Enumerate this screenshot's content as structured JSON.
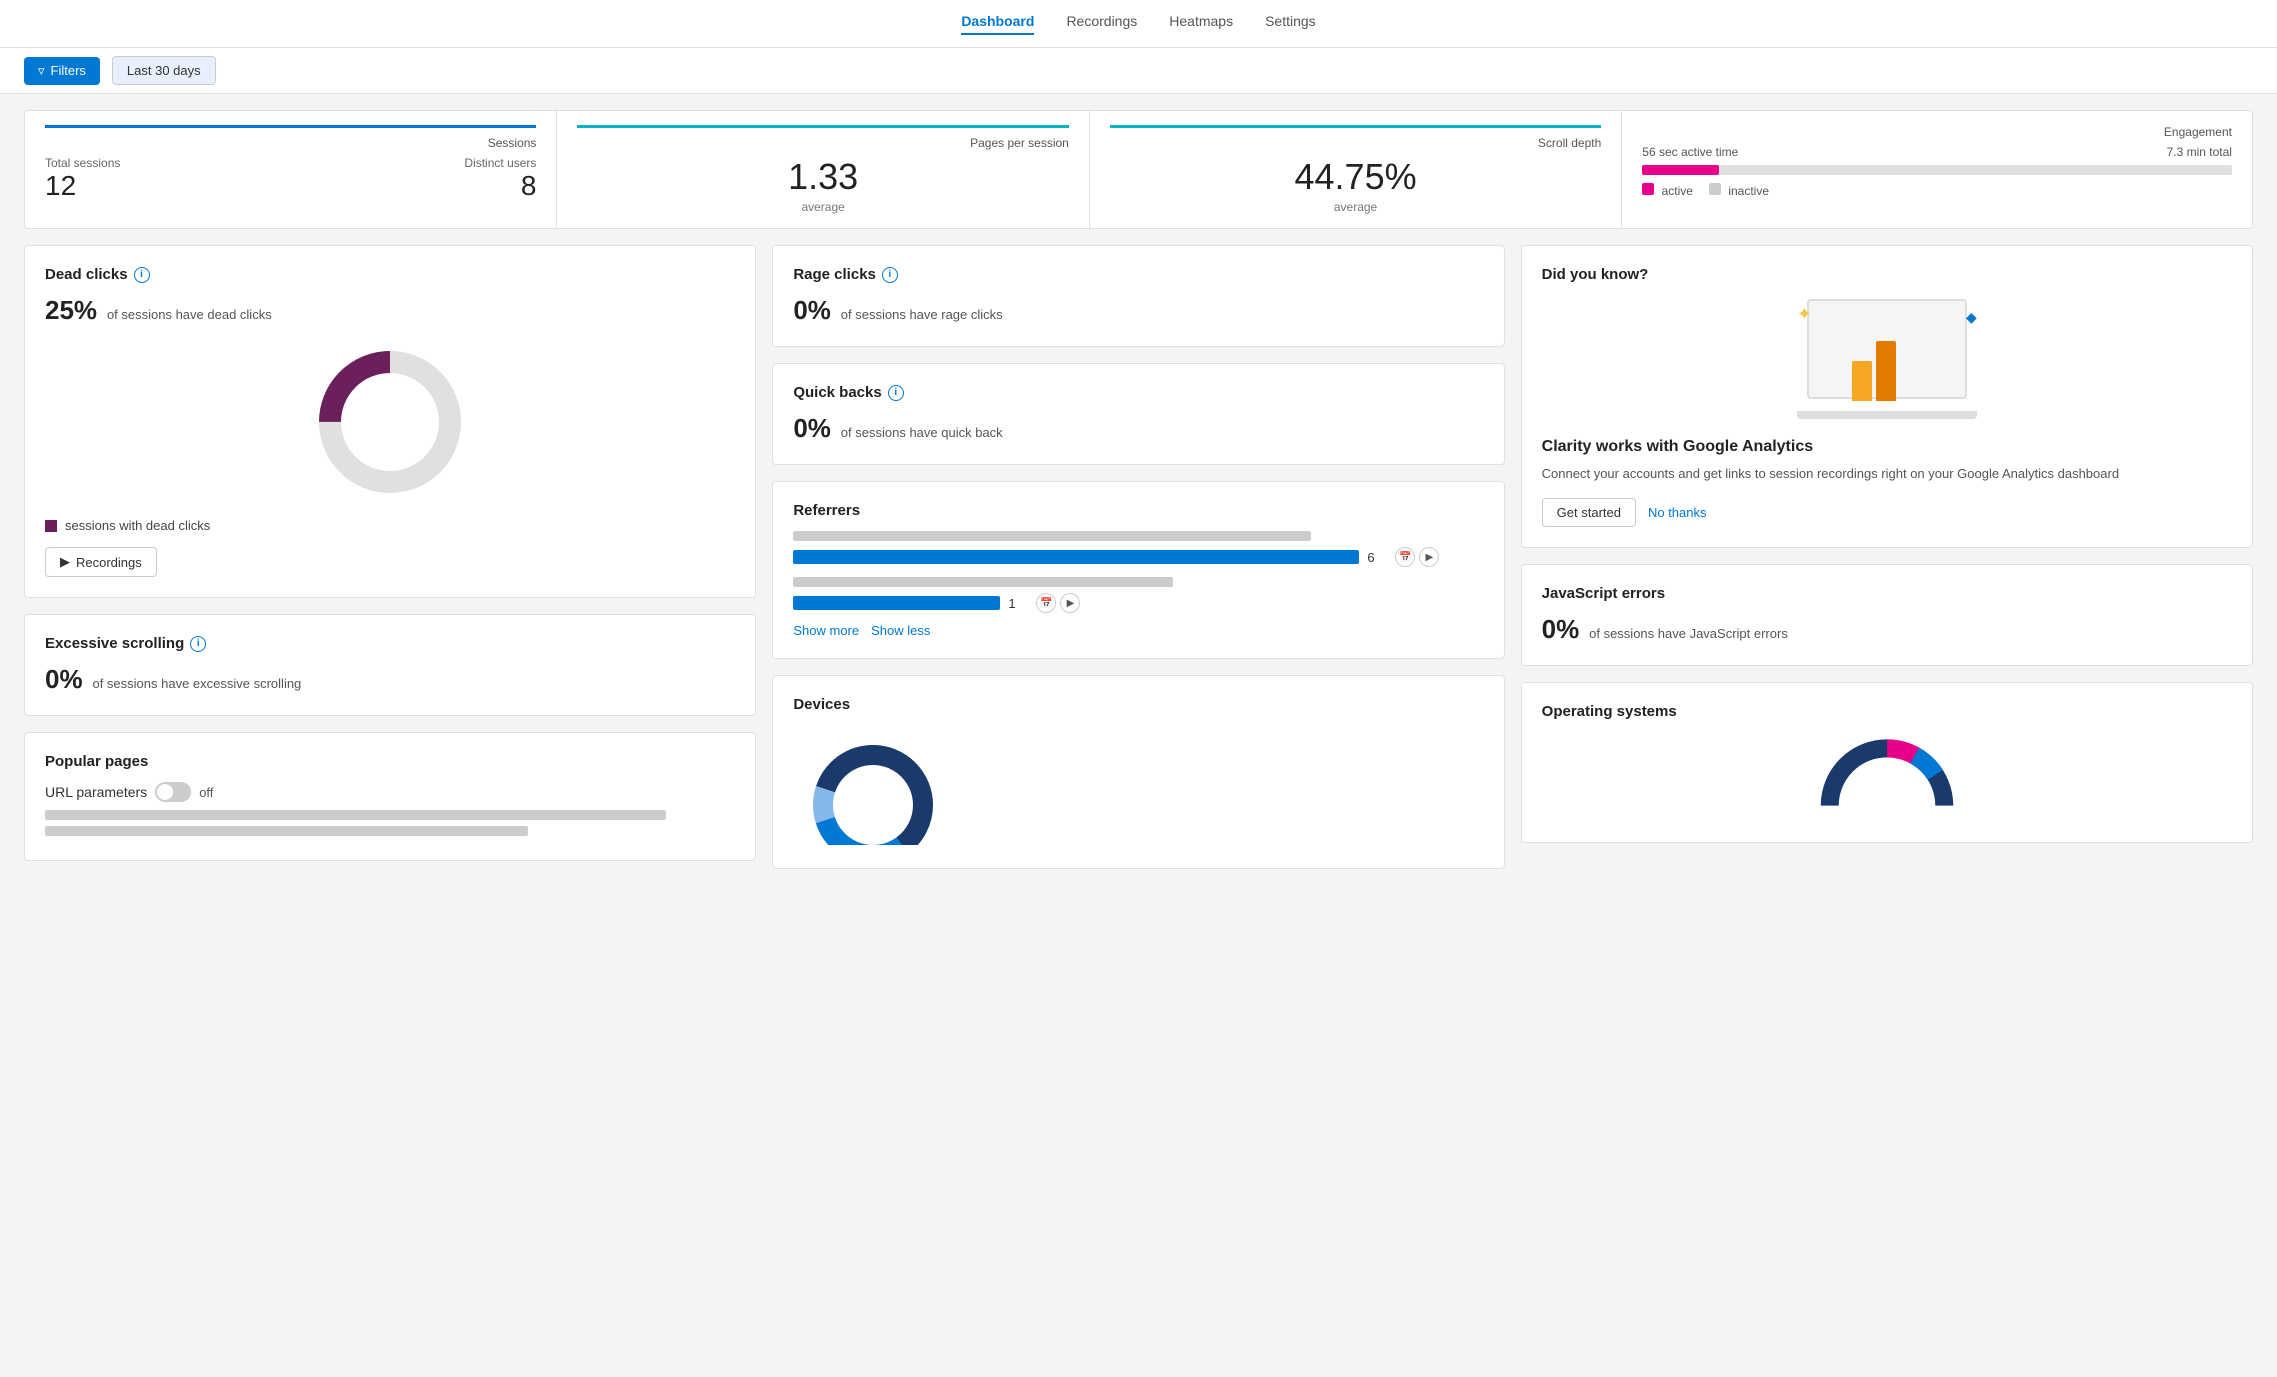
{
  "nav": {
    "links": [
      "Dashboard",
      "Recordings",
      "Heatmaps",
      "Settings"
    ],
    "active": "Dashboard"
  },
  "toolbar": {
    "filters_label": "Filters",
    "date_label": "Last 30 days"
  },
  "stats": {
    "sessions_label": "Sessions",
    "total_sessions_label": "Total sessions",
    "total_sessions_value": "12",
    "distinct_users_label": "Distinct users",
    "distinct_users_value": "8",
    "pages_per_session_label": "Pages per session",
    "pages_per_session_value": "1.33",
    "pages_per_session_avg": "average",
    "scroll_depth_label": "Scroll depth",
    "scroll_depth_value": "44.75%",
    "scroll_depth_avg": "average",
    "engagement_label": "Engagement",
    "engagement_active_time": "56 sec active time",
    "engagement_total": "7.3 min total",
    "engagement_active_label": "active",
    "engagement_inactive_label": "inactive",
    "engagement_active_pct": 13
  },
  "dead_clicks": {
    "title": "Dead clicks",
    "percentage": "25%",
    "description": "of sessions have dead clicks",
    "legend": "sessions with dead clicks",
    "donut_active_pct": 25,
    "recordings_label": "Recordings"
  },
  "rage_clicks": {
    "title": "Rage clicks",
    "percentage": "0%",
    "description": "of sessions have rage clicks"
  },
  "quick_backs": {
    "title": "Quick backs",
    "percentage": "0%",
    "description": "of sessions have quick back"
  },
  "excessive_scrolling": {
    "title": "Excessive scrolling",
    "percentage": "0%",
    "description": "of sessions have excessive scrolling"
  },
  "referrers": {
    "title": "Referrers",
    "items": [
      {
        "url_width": 82,
        "count": "6",
        "show_url": true
      },
      {
        "url_width": 30,
        "count": "1",
        "show_url": true
      }
    ],
    "show_more": "Show more",
    "show_less": "Show less"
  },
  "devices": {
    "title": "Devices"
  },
  "did_you_know": {
    "title": "Did you know?",
    "card_title": "Clarity works with Google Analytics",
    "card_desc": "Connect your accounts and get links to session recordings right on your Google Analytics dashboard",
    "get_started_label": "Get started",
    "no_thanks_label": "No thanks"
  },
  "javascript_errors": {
    "title": "JavaScript errors",
    "percentage": "0%",
    "description": "of sessions have JavaScript errors"
  },
  "operating_systems": {
    "title": "Operating systems"
  },
  "popular_pages": {
    "title": "Popular pages",
    "url_params_label": "URL parameters",
    "url_params_state": "off"
  }
}
